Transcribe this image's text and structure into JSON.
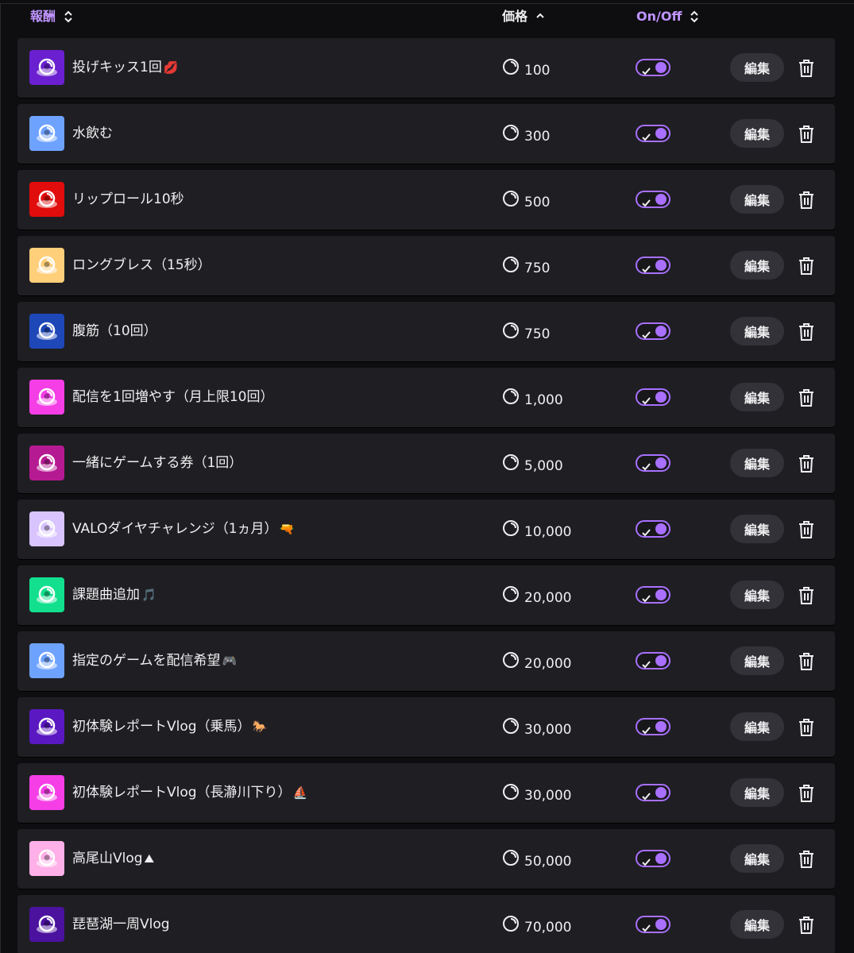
{
  "header": {
    "reward_label": "報酬",
    "price_label": "価格",
    "onoff_label": "On/Off",
    "accent_color": "#bf94ff"
  },
  "edit_label": "編集",
  "rewards": [
    {
      "title": "投げキッス1回",
      "emoji": "💋",
      "price": "100",
      "color": "#6a1fd0",
      "enabled": true
    },
    {
      "title": "水飲む",
      "emoji": "",
      "price": "300",
      "color": "#6ea2ff",
      "enabled": true
    },
    {
      "title": "リップロール10秒",
      "emoji": "",
      "price": "500",
      "color": "#e10c0c",
      "enabled": true
    },
    {
      "title": "ロングブレス（15秒）",
      "emoji": "",
      "price": "750",
      "color": "#ffcf7a",
      "enabled": true
    },
    {
      "title": "腹筋（10回）",
      "emoji": "",
      "price": "750",
      "color": "#1e47b8",
      "enabled": true
    },
    {
      "title": "配信を1回増やす（月上限10回）",
      "emoji": "",
      "price": "1,000",
      "color": "#f53ee6",
      "enabled": true
    },
    {
      "title": "一緒にゲームする券（1回）",
      "emoji": "",
      "price": "5,000",
      "color": "#b61a92",
      "enabled": true
    },
    {
      "title": "VALOダイヤチャレンジ（1ヵ月）",
      "emoji": "🔫",
      "price": "10,000",
      "color": "#d9c4ff",
      "enabled": true
    },
    {
      "title": "課題曲追加",
      "emoji": "🎵",
      "price": "20,000",
      "color": "#12e08e",
      "enabled": true
    },
    {
      "title": "指定のゲームを配信希望",
      "emoji": "🎮",
      "price": "20,000",
      "color": "#6ea2ff",
      "enabled": true
    },
    {
      "title": "初体験レポートVlog（乗馬）",
      "emoji": "🐎",
      "price": "30,000",
      "color": "#5a18c2",
      "enabled": true
    },
    {
      "title": "初体験レポートVlog（長瀞川下り）",
      "emoji": "⛵",
      "price": "30,000",
      "color": "#f53ee6",
      "enabled": true
    },
    {
      "title": "高尾山Vlog",
      "emoji": "⛰",
      "price": "50,000",
      "color": "#ffb0e8",
      "enabled": true
    },
    {
      "title": "琵琶湖一周Vlog",
      "emoji": "",
      "price": "70,000",
      "color": "#4a129e",
      "enabled": true
    }
  ]
}
